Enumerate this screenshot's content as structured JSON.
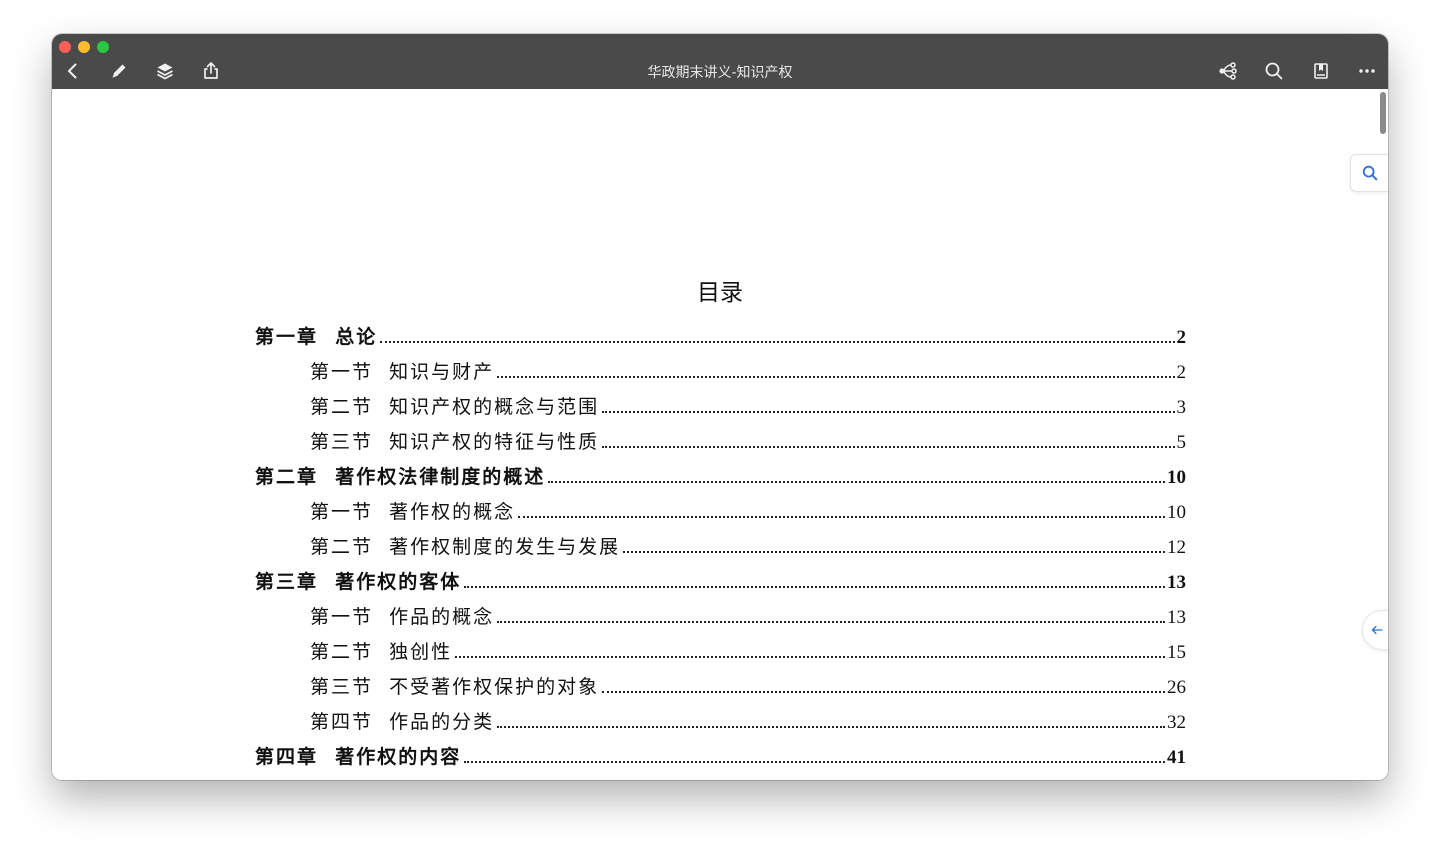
{
  "window": {
    "title": "华政期末讲义-知识产权"
  },
  "toolbar": {
    "left_icons": [
      "back-icon",
      "pencil-icon",
      "layers-icon",
      "share-icon"
    ],
    "right_icons": [
      "mindmap-icon",
      "search-icon",
      "bookmark-icon",
      "more-icon"
    ]
  },
  "document": {
    "heading": "目录",
    "toc": [
      {
        "level": "chapter",
        "label": "第一章  总论",
        "page": "2"
      },
      {
        "level": "section",
        "label": "第一节  知识与财产",
        "page": "2"
      },
      {
        "level": "section",
        "label": "第二节  知识产权的概念与范围",
        "page": "3"
      },
      {
        "level": "section",
        "label": "第三节  知识产权的特征与性质",
        "page": "5"
      },
      {
        "level": "chapter",
        "label": "第二章  著作权法律制度的概述",
        "page": "10"
      },
      {
        "level": "section",
        "label": "第一节  著作权的概念",
        "page": "10"
      },
      {
        "level": "section",
        "label": "第二节  著作权制度的发生与发展",
        "page": "12"
      },
      {
        "level": "chapter",
        "label": "第三章  著作权的客体",
        "page": "13"
      },
      {
        "level": "section",
        "label": "第一节  作品的概念",
        "page": "13"
      },
      {
        "level": "section",
        "label": "第二节  独创性",
        "page": "15"
      },
      {
        "level": "section",
        "label": "第三节  不受著作权保护的对象",
        "page": "26"
      },
      {
        "level": "section",
        "label": "第四节  作品的分类",
        "page": "32"
      },
      {
        "level": "chapter",
        "label": "第四章  著作权的内容",
        "page": "41"
      }
    ]
  },
  "colors": {
    "titlebar": "#4a4a4a",
    "accent": "#2f6fd1"
  }
}
